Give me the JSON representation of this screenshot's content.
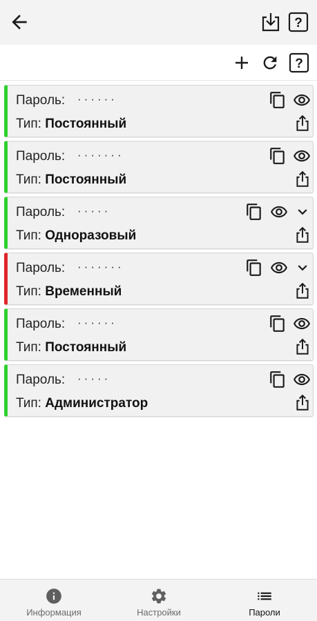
{
  "appbar": {
    "back_icon": "arrow-left-icon",
    "download_icon": "download-icon",
    "help_icon": "help-box-icon"
  },
  "toolbar": {
    "add_icon": "plus-icon",
    "refresh_icon": "refresh-icon",
    "help_icon": "help-box-icon"
  },
  "labels": {
    "password": "Пароль:",
    "type": "Тип:"
  },
  "passwords": [
    {
      "dots": "······",
      "type": "Постоянный",
      "status": "green",
      "expandable": false
    },
    {
      "dots": "·······",
      "type": "Постоянный",
      "status": "green",
      "expandable": false
    },
    {
      "dots": "·····",
      "type": "Одноразовый",
      "status": "green",
      "expandable": true
    },
    {
      "dots": "·······",
      "type": "Временный",
      "status": "red",
      "expandable": true
    },
    {
      "dots": "······",
      "type": "Постоянный",
      "status": "green",
      "expandable": false
    },
    {
      "dots": "·····",
      "type": "Администратор",
      "status": "green",
      "expandable": false
    }
  ],
  "colors": {
    "active": "#2ed12e",
    "expired": "#e0262a",
    "card_bg": "#f1f1f1",
    "bar_bg": "#f3f3f3"
  },
  "bottom_nav": {
    "info": "Информация",
    "settings": "Настройки",
    "passwords": "Пароли",
    "selected": "passwords"
  }
}
